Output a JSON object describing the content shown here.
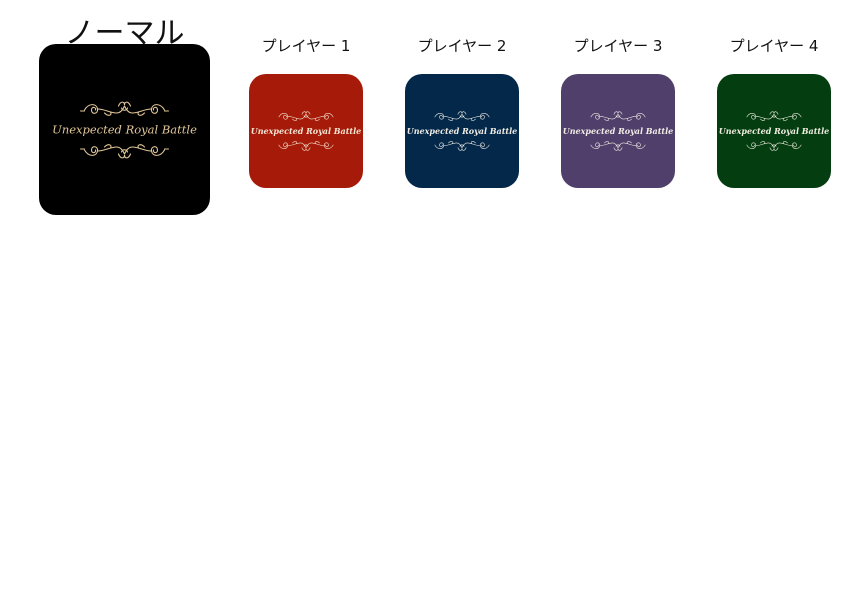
{
  "cards": [
    {
      "label": "ノーマル",
      "title": "Unexpected Royal Battle",
      "bg": "#000000",
      "ornament": "#e3c89a"
    },
    {
      "label": "プレイヤー 1",
      "title": "Unexpected Royal Battle",
      "bg": "#a51a08",
      "ornament": "#f4e6d4"
    },
    {
      "label": "プレイヤー 2",
      "title": "Unexpected Royal Battle",
      "bg": "#03284a",
      "ornament": "#f1ece4"
    },
    {
      "label": "プレイヤー 3",
      "title": "Unexpected Royal Battle",
      "bg": "#4f3f6a",
      "ornament": "#f3ece6"
    },
    {
      "label": "プレイヤー 4",
      "title": "Unexpected Royal Battle",
      "bg": "#033d10",
      "ornament": "#f1ece0"
    }
  ]
}
